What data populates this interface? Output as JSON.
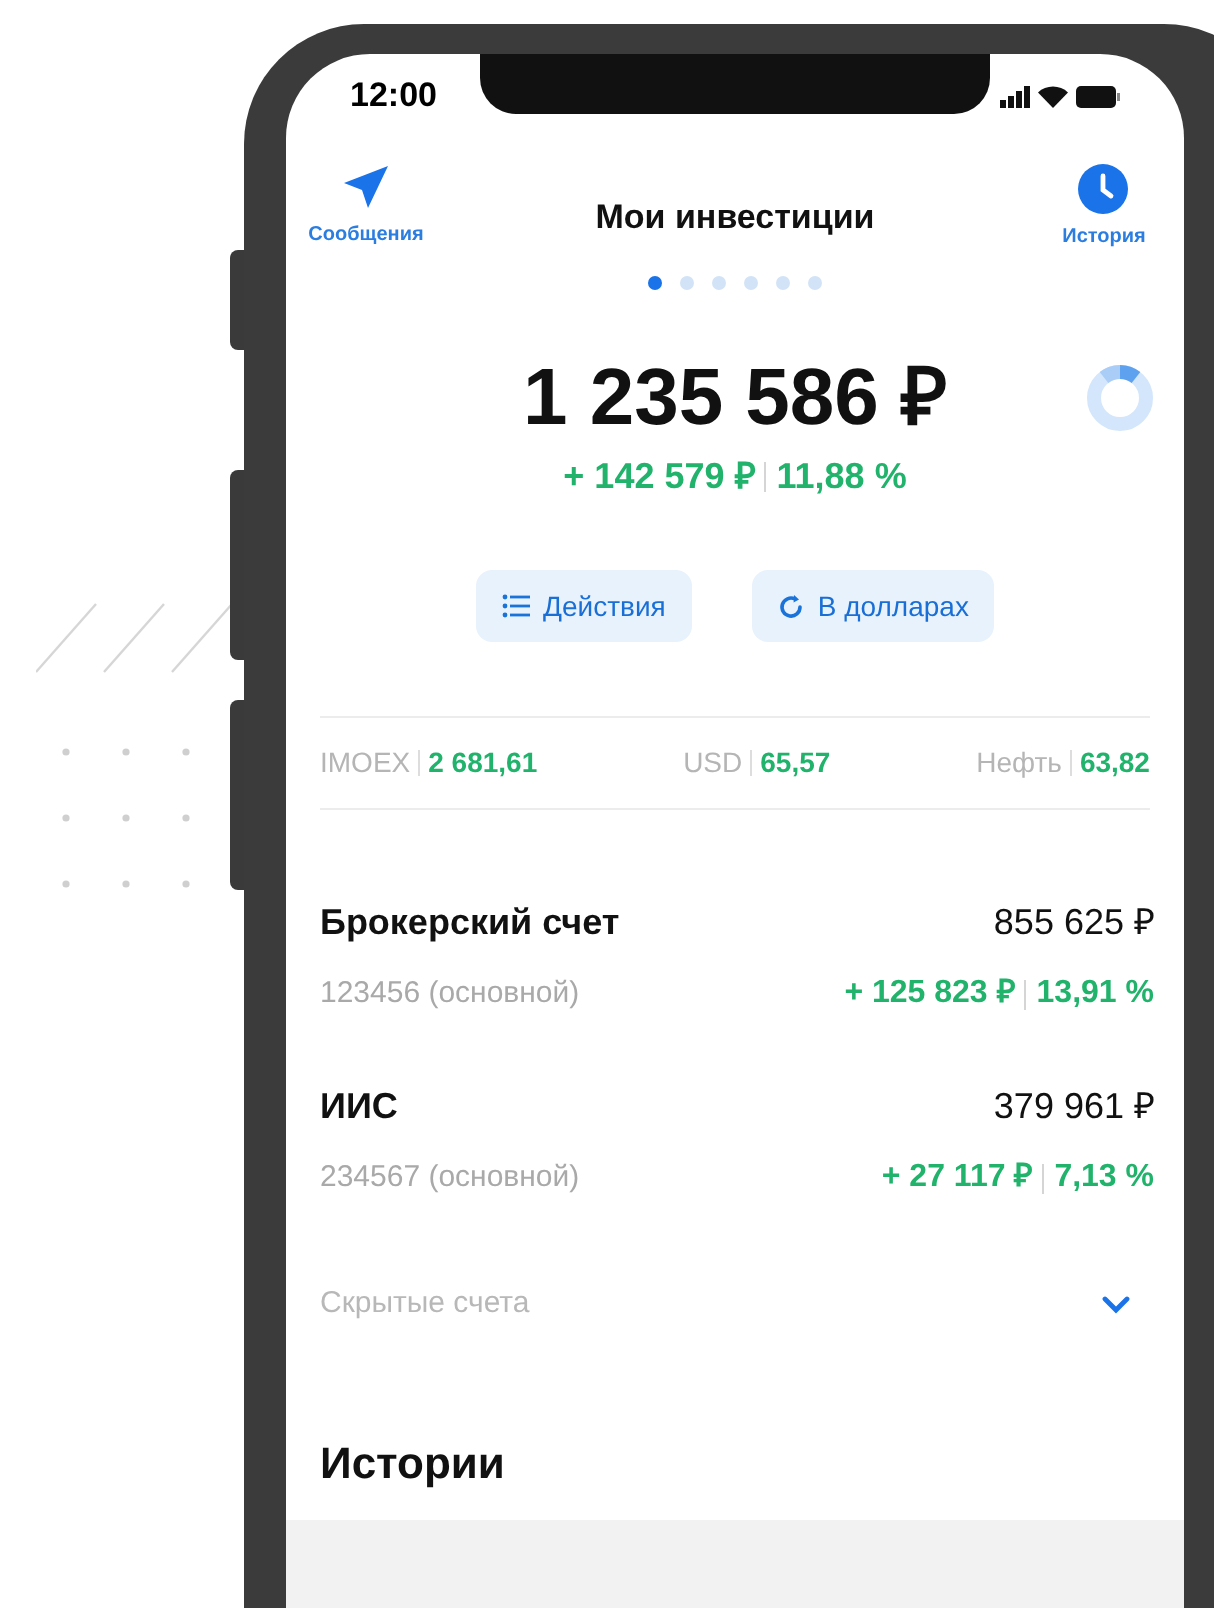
{
  "status_bar": {
    "time": "12:00"
  },
  "header": {
    "left_action": {
      "label": "Сообщения"
    },
    "title": "Мои инвестиции",
    "right_action": {
      "label": "История"
    }
  },
  "pager": [
    {
      "selected": true
    },
    {
      "selected": false
    },
    {
      "selected": false
    },
    {
      "selected": false
    },
    {
      "selected": false
    },
    {
      "selected": false
    }
  ],
  "total": {
    "amount": "1 235 586 ₽",
    "change": "+ 142 579 ₽",
    "change_percent": "11,88 %"
  },
  "actions": [
    {
      "kind": "list",
      "label": "Действия"
    },
    {
      "kind": "refresh",
      "label": "В долларах"
    }
  ],
  "tickers": [
    {
      "name": "IMOEX",
      "value": "2 681,61"
    },
    {
      "name": "USD",
      "value": "65,57"
    },
    {
      "name": "Нефть",
      "value": "63,82"
    }
  ],
  "accounts": [
    {
      "name": "Брокерский счет",
      "amount": "855 625 ₽",
      "number": "123456 (основной)",
      "change": "+ 125 823 ₽",
      "change_percent": "13,91 %"
    },
    {
      "name": "ИИС",
      "amount": "379 961 ₽",
      "number": "234567 (основной)",
      "change": "+ 27 117 ₽",
      "change_percent": "7,13 %"
    }
  ],
  "hidden_accounts": {
    "label": "Скрытые счета",
    "expanded": false
  },
  "stories": {
    "title": "Истории"
  }
}
